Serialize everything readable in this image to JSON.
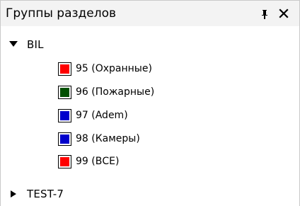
{
  "panel": {
    "title": "Группы разделов",
    "pin_icon": "pin-icon",
    "close_icon": "close-icon"
  },
  "tree": {
    "nodes": [
      {
        "label": "BIL",
        "expanded": true,
        "children": [
          {
            "label": "95 (Охранные)",
            "color": "#ff0000"
          },
          {
            "label": "96 (Пожарные)",
            "color": "#005000"
          },
          {
            "label": "97 (Adem)",
            "color": "#0000cc"
          },
          {
            "label": "98 (Камеры)",
            "color": "#0000cc"
          },
          {
            "label": "99 (ВСЕ)",
            "color": "#ff0000"
          }
        ]
      },
      {
        "label": "TEST-7",
        "expanded": false,
        "children": []
      }
    ]
  }
}
